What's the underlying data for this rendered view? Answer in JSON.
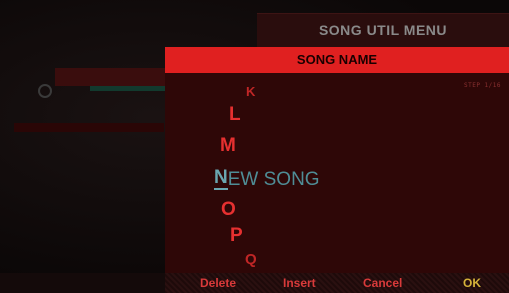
{
  "util_menu": {
    "title": "SONG UTIL MENU"
  },
  "dialog": {
    "title": "SONG NAME",
    "step": "STEP 1/16",
    "name": {
      "cursor_char": "N",
      "rest": "EW SONG"
    },
    "char_picker": {
      "above": [
        "K",
        "L",
        "M"
      ],
      "below": [
        "O",
        "P",
        "Q"
      ]
    }
  },
  "footer": {
    "delete": "Delete",
    "insert": "Insert",
    "cancel": "Cancel",
    "ok": "OK"
  },
  "colors": {
    "accent_red": "#e02020",
    "dialog_bg": "#2e0707",
    "name_text": "#4f8d96",
    "ok_yellow": "#d6b33a"
  }
}
